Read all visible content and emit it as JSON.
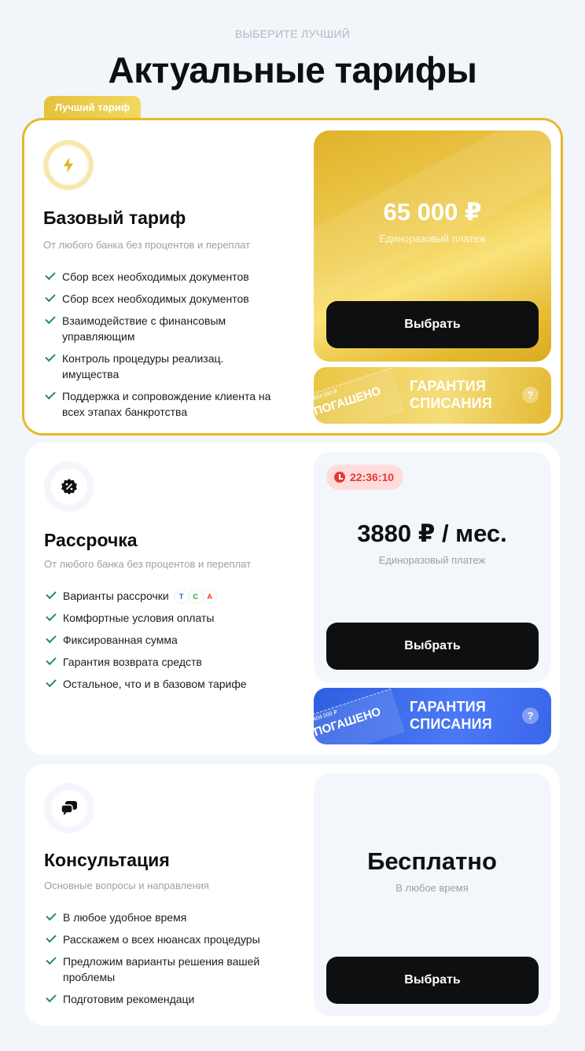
{
  "header": {
    "eyebrow": "ВЫБЕРИТЕ ЛУЧШИЙ",
    "title": "Актуальные тарифы"
  },
  "best_tag": "Лучший тариф",
  "colors": {
    "gold": "#e4b92c",
    "dark": "#0e0f11",
    "check": "#1f8f5f",
    "blue": "#3a66ea",
    "timer_red": "#e53935"
  },
  "tariffs": [
    {
      "icon": "lightning-icon",
      "title": "Базовый тариф",
      "subtitle": "От любого банка без процентов и переплат",
      "features": [
        "Сбор всех необходимых документов",
        "Сбор всех необходимых документов",
        "Взаимодействие с финансовым управляющим",
        "Контроль процедуры реализац. имущества",
        "Поддержка и сопровождение клиента на всех этапах банкротства"
      ],
      "price": "65 000 ₽",
      "price_note": "Единоразовый платеж",
      "button": "Выбрать",
      "guarantee": {
        "stamp_amount": "404 000 ₽",
        "stamp_text": "ПОГАШЕНО",
        "text": "ГАРАНТИЯ СПИСАНИЯ",
        "help": "?"
      }
    },
    {
      "icon": "percent-badge-icon",
      "title": "Рассрочка",
      "subtitle": "От любого банка без процентов и переплат",
      "features": [
        "Варианты рассрочки",
        "Комфортные условия оплаты",
        "Фиксированная сумма",
        "Гарантия возврата средств",
        "Остальное, что и в базовом тарифе"
      ],
      "banks": [
        "Т",
        "С",
        "А"
      ],
      "timer": "22:36:10",
      "price": "3880 ₽ / мес.",
      "price_note": "Единоразовый платеж",
      "button": "Выбрать",
      "guarantee": {
        "stamp_amount": "404 000 ₽",
        "stamp_text": "ПОГАШЕНО",
        "text": "ГАРАНТИЯ СПИСАНИЯ",
        "help": "?"
      }
    },
    {
      "icon": "chat-bubbles-icon",
      "title": "Консультация",
      "subtitle": "Основные вопросы и направления",
      "features": [
        "В любое удобное время",
        "Расскажем о всех нюансах процедуры",
        "Предложим варианты решения вашей проблемы",
        "Подготовим рекомендаци"
      ],
      "price": "Бесплатно",
      "price_note": "В любое время",
      "button": "Выбрать"
    }
  ]
}
